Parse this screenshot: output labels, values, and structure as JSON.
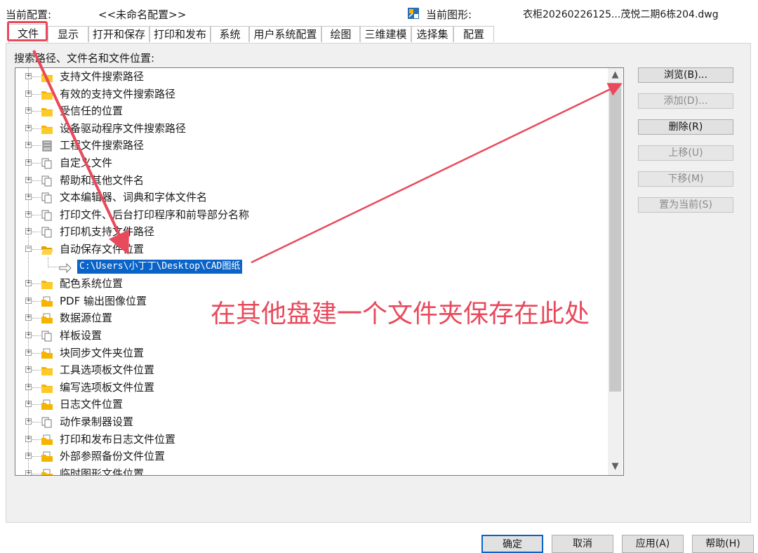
{
  "header": {
    "current_config_label": "当前配置:",
    "current_config_value": "<<未命名配置>>",
    "current_drawing_label": "当前图形:",
    "current_drawing_value": "衣柜20260226125...茂悦二期6栋204.dwg",
    "drawing_icon": "drawing-file-icon"
  },
  "tabs": [
    {
      "label": "文件",
      "active": true
    },
    {
      "label": "显示"
    },
    {
      "label": "打开和保存"
    },
    {
      "label": "打印和发布"
    },
    {
      "label": "系统"
    },
    {
      "label": "用户系统配置"
    },
    {
      "label": "绘图"
    },
    {
      "label": "三维建模"
    },
    {
      "label": "选择集"
    },
    {
      "label": "配置"
    }
  ],
  "panel_title": "搜索路径、文件名和文件位置:",
  "tree": {
    "items": [
      {
        "label": "支持文件搜索路径",
        "icon": "folder-icon",
        "expanded": false
      },
      {
        "label": "有效的支持文件搜索路径",
        "icon": "folder-icon",
        "expanded": false
      },
      {
        "label": "受信任的位置",
        "icon": "folder-icon",
        "expanded": false
      },
      {
        "label": "设备驱动程序文件搜索路径",
        "icon": "folder-icon",
        "expanded": false
      },
      {
        "label": "工程文件搜索路径",
        "icon": "cabinet-icon",
        "expanded": false
      },
      {
        "label": "自定义文件",
        "icon": "documents-icon",
        "expanded": false
      },
      {
        "label": "帮助和其他文件名",
        "icon": "documents-icon",
        "expanded": false
      },
      {
        "label": "文本编辑器、词典和字体文件名",
        "icon": "documents-icon",
        "expanded": false
      },
      {
        "label": "打印文件、后台打印程序和前导部分名称",
        "icon": "documents-icon",
        "expanded": false
      },
      {
        "label": "打印机支持文件路径",
        "icon": "documents-icon",
        "expanded": false
      },
      {
        "label": "自动保存文件位置",
        "icon": "open-folder-icon",
        "expanded": true,
        "child": "C:\\Users\\小丁丁\\Desktop\\CAD图纸"
      },
      {
        "label": "配色系统位置",
        "icon": "folder-icon",
        "expanded": false
      },
      {
        "label": "PDF 输出图像位置",
        "icon": "folder-doc-icon",
        "expanded": false
      },
      {
        "label": "数据源位置",
        "icon": "folder-doc-icon",
        "expanded": false
      },
      {
        "label": "样板设置",
        "icon": "documents-icon",
        "expanded": false
      },
      {
        "label": "块同步文件夹位置",
        "icon": "folder-doc-icon",
        "expanded": false
      },
      {
        "label": "工具选项板文件位置",
        "icon": "folder-icon",
        "expanded": false
      },
      {
        "label": "编写选项板文件位置",
        "icon": "folder-icon",
        "expanded": false
      },
      {
        "label": "日志文件位置",
        "icon": "folder-doc-icon",
        "expanded": false
      },
      {
        "label": "动作录制器设置",
        "icon": "documents-icon",
        "expanded": false
      },
      {
        "label": "打印和发布日志文件位置",
        "icon": "folder-doc-icon",
        "expanded": false
      },
      {
        "label": "外部参照备份文件位置",
        "icon": "folder-doc-icon",
        "expanded": false
      },
      {
        "label": "临时图形文件位置",
        "icon": "folder-doc-icon",
        "expanded": false
      }
    ]
  },
  "side_buttons": [
    {
      "label": "浏览(B)...",
      "enabled": true
    },
    {
      "label": "添加(D)...",
      "enabled": false
    },
    {
      "label": "删除(R)",
      "enabled": true
    },
    {
      "label": "上移(U)",
      "enabled": false
    },
    {
      "label": "下移(M)",
      "enabled": false
    },
    {
      "label": "置为当前(S)",
      "enabled": false
    }
  ],
  "bottom_buttons": [
    {
      "label": "确定",
      "default": true
    },
    {
      "label": "取消"
    },
    {
      "label": "应用(A)"
    },
    {
      "label": "帮助(H)"
    }
  ],
  "annotation": {
    "text": "在其他盘建一个文件夹保存在此处",
    "color": "#e8495b"
  },
  "colors": {
    "selection": "#0a64c8",
    "folder": "#f5b400",
    "annotation": "#e8495b"
  }
}
